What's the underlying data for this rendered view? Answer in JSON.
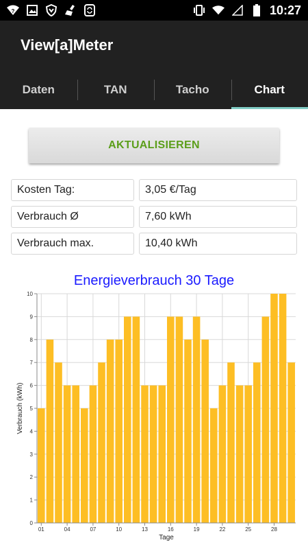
{
  "status": {
    "time": "10:27",
    "icons": [
      "wifi-question-icon",
      "image-icon",
      "shield-icon",
      "broom-icon",
      "sync-icon",
      "vibrate-icon",
      "wifi-icon",
      "signal-icon",
      "battery-icon"
    ]
  },
  "app": {
    "title": "View[a]Meter"
  },
  "tabs": [
    {
      "label": "Daten",
      "active": false
    },
    {
      "label": "TAN",
      "active": false
    },
    {
      "label": "Tacho",
      "active": false
    },
    {
      "label": "Chart",
      "active": true
    }
  ],
  "refresh_button": {
    "label": "AKTUALISIEREN"
  },
  "stats": [
    {
      "label": "Kosten Tag:",
      "value": "3,05 €/Tag"
    },
    {
      "label": "Verbrauch Ø",
      "value": "7,60 kWh"
    },
    {
      "label": "Verbrauch max.",
      "value": "10,40 kWh"
    }
  ],
  "colors": {
    "bar": "#FDBE24",
    "title": "#1A1AFF",
    "button_text": "#5B9E1A",
    "tab_indicator": "#80CBC4",
    "app_bar": "#212121"
  },
  "chart_data": {
    "type": "bar",
    "title": "Energieverbrauch 30 Tage",
    "xlabel": "Tage",
    "ylabel": "Verbrauch (kWh)",
    "ylim": [
      0,
      10
    ],
    "y_ticks": [
      "0",
      "1",
      "2",
      "3",
      "4",
      "5",
      "6",
      "7",
      "8",
      "9",
      "10"
    ],
    "x_tick_labels": [
      "01",
      "04",
      "07",
      "10",
      "13",
      "16",
      "19",
      "22",
      "25",
      "28"
    ],
    "grid": true,
    "categories": [
      "01",
      "02",
      "03",
      "04",
      "05",
      "06",
      "07",
      "08",
      "09",
      "10",
      "11",
      "12",
      "13",
      "14",
      "15",
      "16",
      "17",
      "18",
      "19",
      "20",
      "21",
      "22",
      "23",
      "24",
      "25",
      "26",
      "27",
      "28",
      "29",
      "30"
    ],
    "values": [
      5,
      8,
      7,
      6,
      6,
      5,
      6,
      7,
      8,
      8,
      9,
      9,
      6,
      6,
      6,
      9,
      9,
      8,
      9,
      8,
      5,
      6,
      7,
      6,
      6,
      7,
      9,
      10,
      10,
      7
    ]
  }
}
